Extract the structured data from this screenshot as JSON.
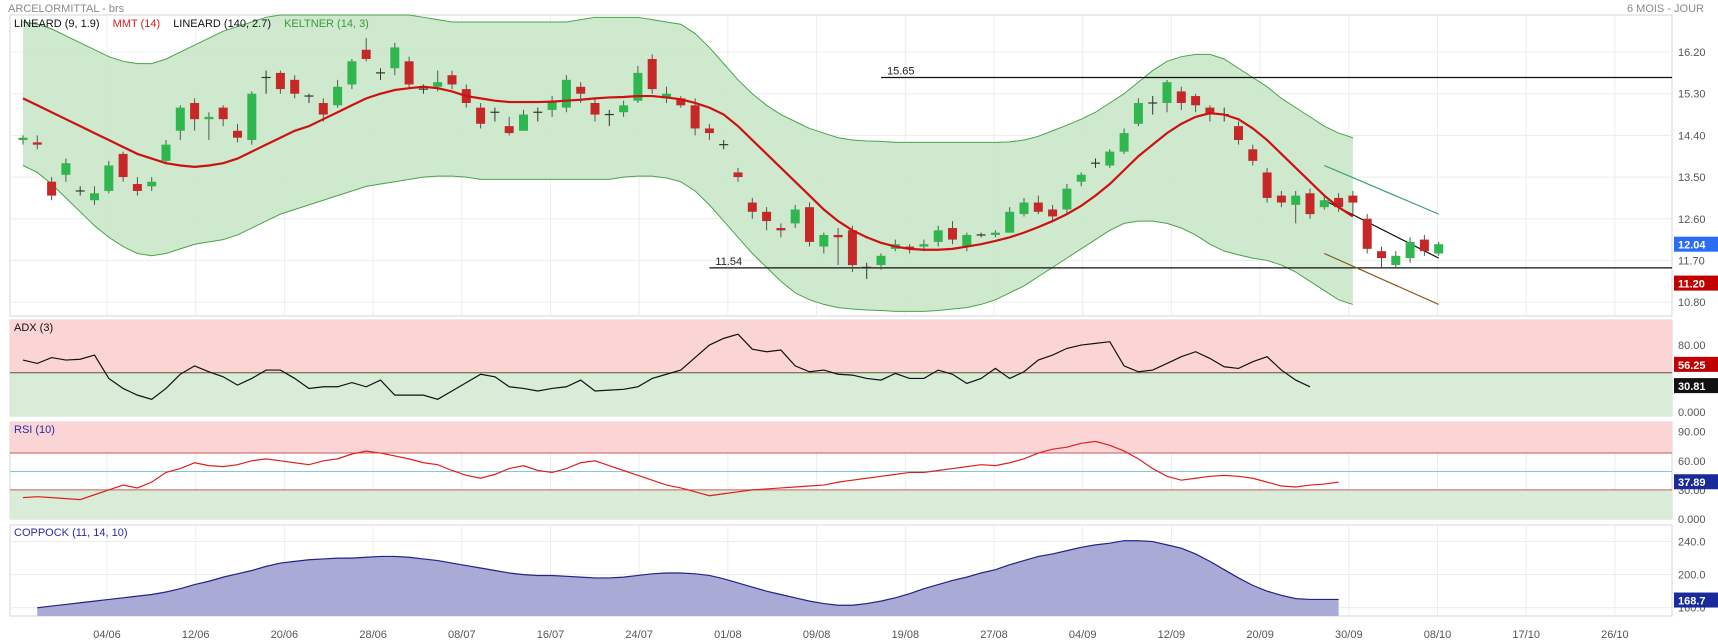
{
  "header": {
    "title": "ARCELORMITTAL - brs",
    "period": "6 MOIS - JOUR"
  },
  "legend": {
    "main": [
      {
        "text": "LINEARD (9, 1.9)",
        "color": "#111111"
      },
      {
        "text": "MMT (14)",
        "color": "#d42020"
      },
      {
        "text": "LINEARD (140, 2.7)",
        "color": "#111111"
      },
      {
        "text": "KELTNER (14, 3)",
        "color": "#3a9a3a"
      }
    ],
    "adx": "ADX (3)",
    "rsi": "RSI (10)",
    "coppock": "COPPOCK (11, 14, 10)"
  },
  "colors": {
    "up": "#2fb64f",
    "down": "#c62828",
    "keltner_fill": "#cce8cc",
    "keltner_line": "#4aa34a",
    "mmt": "#cc1111",
    "adx_zone": "#fbd5d5",
    "rsi_line": "#e02020",
    "coppock_fill": "#aaaad6",
    "coppock_line": "#22228a",
    "last_price": "#2a6df4",
    "support_badge": "#c00000"
  },
  "chart_data": [
    {
      "panel": "price",
      "type": "candlestick",
      "x_labels": [
        "04/06",
        "12/06",
        "20/06",
        "28/06",
        "08/07",
        "16/07",
        "24/07",
        "01/08",
        "09/08",
        "19/08",
        "27/08",
        "04/09",
        "12/09",
        "20/09",
        "30/09",
        "08/10",
        "17/10",
        "26/10"
      ],
      "y_ticks": [
        "16.20",
        "15.30",
        "14.40",
        "13.50",
        "12.60",
        "11.70",
        "10.80"
      ],
      "ylim": [
        10.5,
        17.0
      ],
      "candles": [
        [
          14.3,
          14.35,
          14.4,
          14.2
        ],
        [
          14.25,
          14.2,
          14.4,
          14.1
        ],
        [
          13.4,
          13.1,
          13.5,
          13.0
        ],
        [
          13.55,
          13.8,
          13.9,
          13.4
        ],
        [
          13.2,
          13.2,
          13.3,
          13.1
        ],
        [
          13.0,
          13.15,
          13.3,
          12.9
        ],
        [
          13.2,
          13.75,
          13.85,
          13.15
        ],
        [
          14.0,
          13.5,
          14.05,
          13.4
        ],
        [
          13.35,
          13.2,
          13.5,
          13.1
        ],
        [
          13.3,
          13.4,
          13.5,
          13.2
        ],
        [
          13.85,
          14.2,
          14.3,
          13.8
        ],
        [
          14.5,
          15.0,
          15.05,
          14.3
        ],
        [
          15.1,
          14.75,
          15.2,
          14.5
        ],
        [
          14.75,
          14.8,
          14.9,
          14.3
        ],
        [
          15.0,
          14.75,
          15.05,
          14.6
        ],
        [
          14.5,
          14.35,
          14.65,
          14.25
        ],
        [
          14.3,
          15.3,
          15.35,
          14.2
        ],
        [
          15.65,
          15.65,
          15.8,
          15.3
        ],
        [
          15.75,
          15.4,
          15.8,
          15.3
        ],
        [
          15.6,
          15.3,
          15.7,
          15.2
        ],
        [
          15.25,
          15.25,
          15.3,
          15.1
        ],
        [
          15.1,
          14.85,
          15.2,
          14.7
        ],
        [
          15.05,
          15.45,
          15.6,
          15.0
        ],
        [
          15.5,
          16.0,
          16.05,
          15.4
        ],
        [
          16.25,
          16.05,
          16.5,
          16.0
        ],
        [
          15.75,
          15.75,
          15.85,
          15.6
        ],
        [
          15.85,
          16.3,
          16.4,
          15.7
        ],
        [
          16.0,
          15.5,
          16.1,
          15.4
        ],
        [
          15.4,
          15.4,
          15.5,
          15.3
        ],
        [
          15.45,
          15.55,
          15.8,
          15.35
        ],
        [
          15.7,
          15.5,
          15.8,
          15.4
        ],
        [
          15.4,
          15.1,
          15.5,
          15.0
        ],
        [
          15.0,
          14.65,
          15.1,
          14.55
        ],
        [
          14.9,
          14.9,
          15.0,
          14.7
        ],
        [
          14.6,
          14.45,
          14.8,
          14.4
        ],
        [
          14.5,
          14.85,
          14.95,
          14.5
        ],
        [
          14.9,
          14.9,
          15.0,
          14.7
        ],
        [
          14.95,
          15.15,
          15.25,
          14.8
        ],
        [
          15.0,
          15.6,
          15.7,
          14.9
        ],
        [
          15.45,
          15.3,
          15.55,
          15.1
        ],
        [
          15.1,
          14.85,
          15.2,
          14.7
        ],
        [
          14.85,
          14.85,
          14.95,
          14.6
        ],
        [
          14.9,
          15.05,
          15.15,
          14.8
        ],
        [
          15.15,
          15.75,
          15.9,
          15.1
        ],
        [
          16.05,
          15.4,
          16.15,
          15.3
        ],
        [
          15.2,
          15.3,
          15.45,
          15.1
        ],
        [
          15.2,
          15.05,
          15.25,
          15.0
        ],
        [
          15.05,
          14.55,
          15.2,
          14.4
        ],
        [
          14.55,
          14.45,
          14.65,
          14.3
        ],
        [
          14.2,
          14.2,
          14.3,
          14.1
        ],
        [
          13.6,
          13.5,
          13.7,
          13.4
        ],
        [
          12.95,
          12.75,
          13.05,
          12.6
        ],
        [
          12.75,
          12.55,
          12.85,
          12.35
        ],
        [
          12.4,
          12.35,
          12.5,
          12.2
        ],
        [
          12.5,
          12.8,
          12.9,
          12.4
        ],
        [
          12.85,
          12.1,
          12.95,
          12.0
        ],
        [
          12.0,
          12.25,
          12.3,
          11.85
        ],
        [
          12.25,
          12.2,
          12.4,
          11.6
        ],
        [
          12.35,
          11.6,
          12.45,
          11.45
        ],
        [
          11.55,
          11.55,
          11.65,
          11.3
        ],
        [
          11.6,
          11.8,
          11.85,
          11.5
        ],
        [
          11.95,
          12.05,
          12.15,
          11.9
        ],
        [
          12.0,
          11.95,
          12.05,
          11.85
        ],
        [
          12.0,
          12.05,
          12.15,
          11.9
        ],
        [
          12.1,
          12.35,
          12.45,
          12.0
        ],
        [
          12.4,
          12.15,
          12.55,
          12.05
        ],
        [
          12.0,
          12.25,
          12.3,
          11.9
        ],
        [
          12.25,
          12.25,
          12.3,
          12.2
        ],
        [
          12.25,
          12.3,
          12.35,
          12.2
        ],
        [
          12.3,
          12.75,
          12.85,
          12.3
        ],
        [
          12.7,
          12.95,
          13.05,
          12.65
        ],
        [
          12.95,
          12.75,
          13.1,
          12.7
        ],
        [
          12.8,
          12.65,
          12.9,
          12.55
        ],
        [
          12.8,
          13.25,
          13.35,
          12.7
        ],
        [
          13.4,
          13.55,
          13.6,
          13.3
        ],
        [
          13.8,
          13.8,
          13.9,
          13.7
        ],
        [
          13.75,
          14.05,
          14.1,
          13.7
        ],
        [
          14.05,
          14.45,
          14.55,
          14.0
        ],
        [
          14.65,
          15.1,
          15.2,
          14.6
        ],
        [
          15.1,
          15.1,
          15.25,
          14.85
        ],
        [
          15.1,
          15.55,
          15.6,
          14.9
        ],
        [
          15.35,
          15.1,
          15.45,
          14.95
        ],
        [
          15.25,
          15.05,
          15.3,
          14.9
        ],
        [
          15.0,
          14.85,
          15.05,
          14.7
        ],
        [
          14.85,
          14.85,
          15.0,
          14.7
        ],
        [
          14.6,
          14.3,
          14.7,
          14.2
        ],
        [
          14.1,
          13.85,
          14.2,
          13.75
        ],
        [
          13.6,
          13.05,
          13.7,
          12.95
        ],
        [
          13.1,
          12.95,
          13.2,
          12.85
        ],
        [
          12.9,
          13.1,
          13.2,
          12.5
        ],
        [
          13.15,
          12.7,
          13.25,
          12.6
        ],
        [
          12.85,
          13.0,
          13.1,
          12.8
        ],
        [
          13.05,
          12.85,
          13.15,
          12.75
        ],
        [
          13.1,
          12.95,
          13.2,
          12.7
        ],
        [
          12.6,
          11.95,
          12.7,
          11.85
        ],
        [
          11.9,
          11.75,
          12.0,
          11.55
        ],
        [
          11.6,
          11.8,
          11.9,
          11.55
        ],
        [
          11.75,
          12.1,
          12.2,
          11.65
        ],
        [
          12.15,
          11.9,
          12.25,
          11.8
        ],
        [
          11.85,
          12.05,
          12.1,
          11.8
        ]
      ],
      "mmt14": [
        15.2,
        15.05,
        14.9,
        14.75,
        14.6,
        14.45,
        14.3,
        14.15,
        14.0,
        13.9,
        13.8,
        13.75,
        13.72,
        13.75,
        13.8,
        13.9,
        14.05,
        14.2,
        14.35,
        14.5,
        14.6,
        14.75,
        14.9,
        15.05,
        15.2,
        15.3,
        15.38,
        15.42,
        15.45,
        15.42,
        15.35,
        15.25,
        15.2,
        15.15,
        15.12,
        15.12,
        15.12,
        15.13,
        15.15,
        15.17,
        15.2,
        15.22,
        15.23,
        15.25,
        15.25,
        15.22,
        15.18,
        15.1,
        15.0,
        14.85,
        14.6,
        14.3,
        14.0,
        13.7,
        13.4,
        13.1,
        12.8,
        12.55,
        12.35,
        12.2,
        12.08,
        12.0,
        11.95,
        11.93,
        11.93,
        11.95,
        12.0,
        12.05,
        12.12,
        12.2,
        12.3,
        12.42,
        12.55,
        12.7,
        12.88,
        13.1,
        13.35,
        13.65,
        13.95,
        14.2,
        14.45,
        14.65,
        14.8,
        14.88,
        14.85,
        14.75,
        14.55,
        14.3,
        14.0,
        13.7,
        13.4,
        13.1,
        12.85,
        12.65
      ],
      "keltner_upper": [
        16.85,
        16.8,
        16.7,
        16.55,
        16.4,
        16.25,
        16.1,
        16.0,
        15.95,
        15.95,
        16.05,
        16.2,
        16.35,
        16.5,
        16.65,
        16.75,
        16.85,
        16.95,
        17.0,
        17.0,
        17.0,
        17.0,
        17.0,
        17.0,
        17.0,
        17.0,
        17.0,
        17.0,
        16.95,
        16.9,
        16.85,
        16.85,
        16.85,
        16.85,
        16.85,
        16.85,
        16.85,
        16.85,
        16.85,
        16.9,
        16.95,
        16.95,
        16.95,
        16.95,
        16.9,
        16.85,
        16.8,
        16.6,
        16.3,
        15.95,
        15.6,
        15.3,
        15.05,
        14.85,
        14.7,
        14.55,
        14.45,
        14.35,
        14.3,
        14.28,
        14.27,
        14.25,
        14.25,
        14.25,
        14.25,
        14.25,
        14.25,
        14.25,
        14.25,
        14.26,
        14.3,
        14.38,
        14.5,
        14.62,
        14.75,
        14.9,
        15.1,
        15.3,
        15.55,
        15.8,
        16.0,
        16.1,
        16.15,
        16.15,
        16.05,
        15.85,
        15.65,
        15.45,
        15.2,
        15.0,
        14.8,
        14.6,
        14.45,
        14.35
      ],
      "keltner_lower": [
        13.75,
        13.6,
        13.35,
        13.05,
        12.75,
        12.45,
        12.2,
        12.0,
        11.85,
        11.8,
        11.85,
        11.95,
        12.05,
        12.1,
        12.15,
        12.25,
        12.4,
        12.55,
        12.7,
        12.8,
        12.9,
        13.0,
        13.1,
        13.2,
        13.3,
        13.35,
        13.4,
        13.45,
        13.5,
        13.52,
        13.52,
        13.5,
        13.45,
        13.45,
        13.45,
        13.45,
        13.45,
        13.45,
        13.45,
        13.45,
        13.45,
        13.45,
        13.5,
        13.52,
        13.52,
        13.48,
        13.4,
        13.2,
        12.9,
        12.55,
        12.2,
        11.85,
        11.55,
        11.25,
        11.0,
        10.85,
        10.75,
        10.68,
        10.65,
        10.63,
        10.62,
        10.6,
        10.6,
        10.6,
        10.62,
        10.65,
        10.68,
        10.75,
        10.85,
        11.0,
        11.15,
        11.35,
        11.55,
        11.75,
        11.95,
        12.15,
        12.35,
        12.5,
        12.55,
        12.55,
        12.5,
        12.4,
        12.25,
        12.05,
        11.9,
        11.82,
        11.75,
        11.7,
        11.6,
        11.45,
        11.25,
        11.05,
        10.85,
        10.75
      ],
      "hlines": [
        {
          "label": "15.65",
          "value": 15.65,
          "from": 60
        },
        {
          "label": "11.54",
          "value": 11.54,
          "from": 48
        }
      ],
      "trend_lines": [
        {
          "from": [
            91,
            13.75
          ],
          "to": [
            99,
            12.7
          ],
          "color": "#3aa06a"
        },
        {
          "from": [
            91,
            13.0
          ],
          "to": [
            99,
            11.75
          ],
          "color": "#111111"
        },
        {
          "from": [
            91,
            11.85
          ],
          "to": [
            99,
            10.75
          ],
          "color": "#8a5a20"
        }
      ],
      "badges": [
        {
          "label": "12.04",
          "value": 12.04,
          "color": "#2a6df4"
        },
        {
          "label": "11.20",
          "value": 11.2,
          "color": "#c00000"
        }
      ]
    },
    {
      "panel": "adx",
      "type": "line",
      "title": "ADX (3)",
      "y_ticks": [
        "80.00",
        "0.000"
      ],
      "ylim": [
        -5,
        110
      ],
      "zone_from": 46.8,
      "hline": 46.8,
      "values": [
        62,
        58,
        65,
        62,
        63,
        68,
        40,
        28,
        20,
        15,
        28,
        45,
        55,
        48,
        42,
        32,
        40,
        50,
        50,
        40,
        28,
        30,
        30,
        35,
        30,
        38,
        20,
        20,
        20,
        15,
        25,
        35,
        45,
        42,
        30,
        28,
        25,
        28,
        30,
        38,
        25,
        26,
        27,
        30,
        40,
        45,
        50,
        65,
        80,
        88,
        93,
        75,
        72,
        74,
        55,
        48,
        50,
        45,
        44,
        40,
        38,
        46,
        40,
        40,
        50,
        45,
        34,
        40,
        52,
        40,
        48,
        62,
        68,
        76,
        80,
        82,
        84,
        55,
        48,
        50,
        58,
        66,
        72,
        64,
        54,
        52,
        60,
        66,
        50,
        38,
        30
      ]
    },
    {
      "panel": "rsi",
      "type": "line",
      "title": "RSI (10)",
      "y_ticks": [
        "90.00",
        "60.00",
        "30.00",
        "0.000"
      ],
      "ylim": [
        0,
        100
      ],
      "hlines": [
        30,
        68
      ],
      "values": [
        22,
        23,
        22,
        21,
        20,
        25,
        30,
        35,
        32,
        38,
        48,
        52,
        58,
        55,
        54,
        56,
        60,
        62,
        60,
        58,
        56,
        60,
        62,
        67,
        70,
        68,
        65,
        62,
        58,
        56,
        50,
        45,
        42,
        46,
        52,
        55,
        50,
        48,
        52,
        58,
        60,
        55,
        50,
        45,
        40,
        35,
        32,
        28,
        24,
        26,
        28,
        30,
        31,
        32,
        33,
        34,
        35,
        38,
        40,
        42,
        44,
        46,
        48,
        48,
        50,
        52,
        54,
        56,
        55,
        58,
        62,
        68,
        72,
        74,
        78,
        80,
        76,
        70,
        62,
        52,
        44,
        40,
        42,
        44,
        45,
        44,
        42,
        38,
        34,
        33,
        35,
        36,
        38
      ]
    },
    {
      "panel": "coppock",
      "type": "area",
      "title": "COPPOCK (11, 14, 10)",
      "y_ticks": [
        "240.0",
        "200.0",
        "160.0"
      ],
      "ylim": [
        150,
        260
      ],
      "badge": {
        "label": "168.7",
        "value": 168.7
      },
      "values": [
        158,
        160,
        162,
        164,
        166,
        168,
        170,
        172,
        174,
        176,
        179,
        183,
        188,
        192,
        197,
        201,
        205,
        210,
        214,
        216,
        218,
        219,
        220,
        220,
        221,
        222,
        222,
        221,
        219,
        217,
        214,
        211,
        208,
        205,
        202,
        200,
        199,
        199,
        198,
        197,
        196,
        196,
        197,
        199,
        201,
        202,
        202,
        201,
        199,
        195,
        190,
        185,
        180,
        176,
        172,
        168,
        165,
        163,
        163,
        165,
        168,
        172,
        177,
        183,
        188,
        193,
        197,
        202,
        206,
        212,
        217,
        222,
        225,
        229,
        233,
        236,
        238,
        241,
        241,
        240,
        236,
        232,
        225,
        216,
        206,
        196,
        187,
        180,
        175,
        171,
        170,
        170,
        170
      ]
    }
  ]
}
